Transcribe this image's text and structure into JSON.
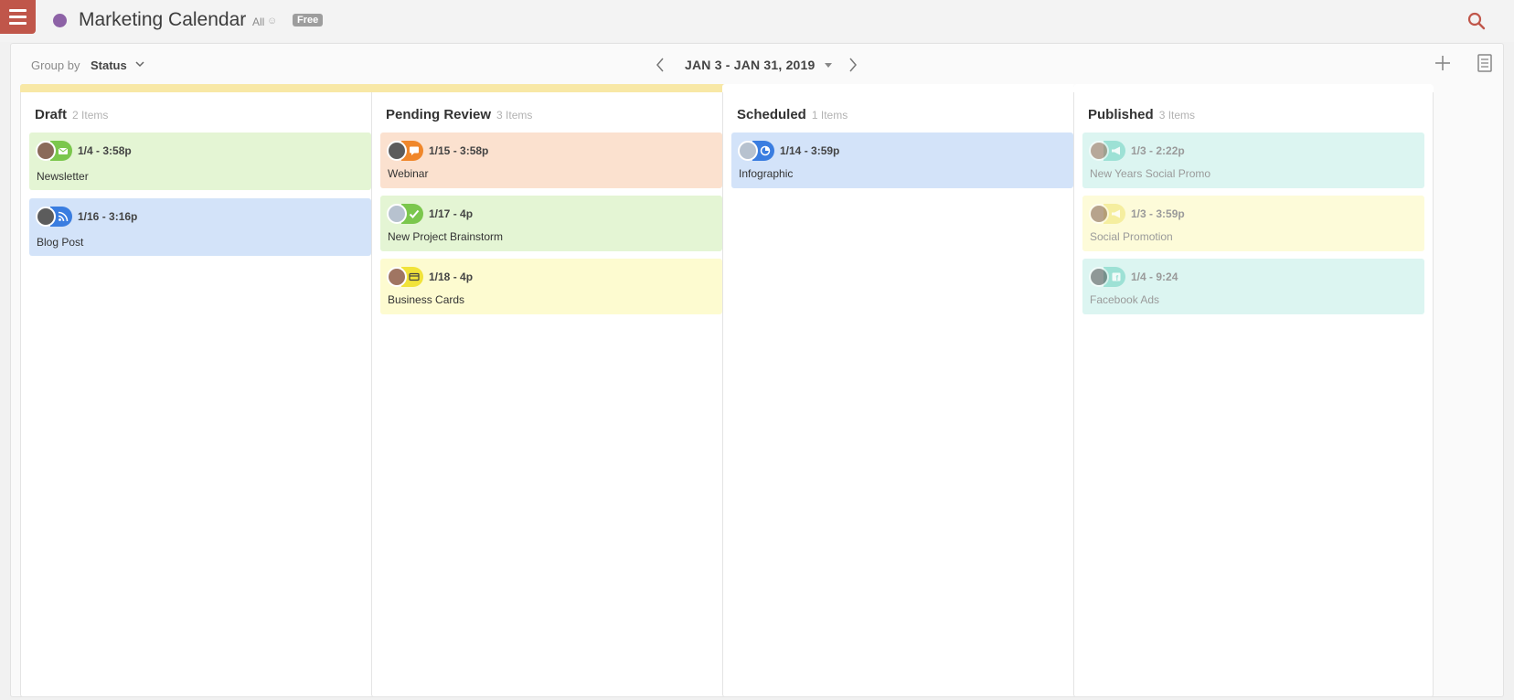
{
  "app": {
    "title": "Marketing Calendar",
    "scope": "All",
    "plan_badge": "Free",
    "calendar_color": "#8d62a6",
    "accent_color": "#c0564a"
  },
  "toolbar": {
    "group_by_label": "Group by",
    "group_by_value": "Status",
    "date_range": "JAN 3 - JAN 31, 2019"
  },
  "icons": {
    "menu": "hamburger-menu-icon",
    "search": "search-icon",
    "prev": "chevron-left-icon",
    "next": "chevron-right-icon",
    "add": "plus-icon",
    "list": "list-view-icon"
  },
  "columns": [
    {
      "name": "Draft",
      "count": "2 Items",
      "accent": "#f8e8a6",
      "cards": [
        {
          "time": "1/4 - 3:58p",
          "title": "Newsletter",
          "color": "#e4f5d4",
          "pill": "#7bc74d",
          "icon": "email-icon"
        },
        {
          "time": "1/16 - 3:16p",
          "title": "Blog Post",
          "color": "#d3e3f9",
          "pill": "#3a7de0",
          "icon": "rss-icon"
        }
      ]
    },
    {
      "name": "Pending Review",
      "count": "3 Items",
      "accent": "#f8e8a6",
      "cards": [
        {
          "time": "1/15 - 3:58p",
          "title": "Webinar",
          "color": "#fbe1cf",
          "pill": "#f0872b",
          "icon": "chat-icon"
        },
        {
          "time": "1/17 - 4p",
          "title": "New Project Brainstorm",
          "color": "#e4f5d4",
          "pill": "#7bc74d",
          "icon": "check-icon"
        },
        {
          "time": "1/18 - 4p",
          "title": "Business Cards",
          "color": "#fdfbd0",
          "pill": "#f1e33a",
          "icon": "card-icon"
        }
      ]
    },
    {
      "name": "Scheduled",
      "count": "1 Items",
      "accent": "#ffffff",
      "cards": [
        {
          "time": "1/14 - 3:59p",
          "title": "Infographic",
          "color": "#d3e3f9",
          "pill": "#3a7de0",
          "icon": "pie-chart-icon"
        }
      ]
    },
    {
      "name": "Published",
      "count": "3 Items",
      "accent": "#ffffff",
      "cards": [
        {
          "time": "1/3 - 2:22p",
          "title": "New Years Social Promo",
          "color": "#dcf5f1",
          "pill": "#74d4c4",
          "icon": "megaphone-icon"
        },
        {
          "time": "1/3 - 3:59p",
          "title": "Social Promotion",
          "color": "#fdfbd9",
          "pill": "#f1e67a",
          "icon": "megaphone-icon"
        },
        {
          "time": "1/4 - 9:24",
          "title": "Facebook Ads",
          "color": "#dcf5f1",
          "pill": "#74d4c4",
          "icon": "facebook-icon"
        }
      ]
    }
  ]
}
